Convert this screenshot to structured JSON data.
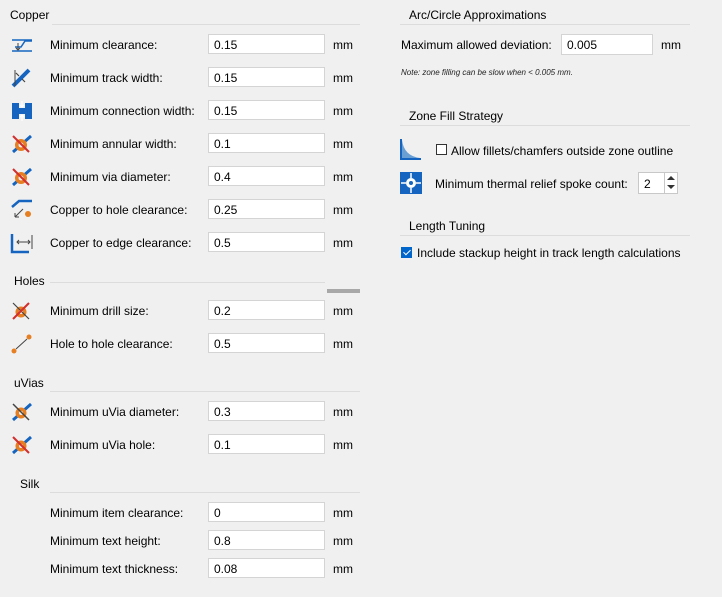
{
  "copper": {
    "title": "Copper",
    "rows": [
      {
        "icon": "clearance-icon",
        "label": "Minimum clearance:",
        "value": "0.15",
        "unit": "mm"
      },
      {
        "icon": "track-width-icon",
        "label": "Minimum track width:",
        "value": "0.15",
        "unit": "mm"
      },
      {
        "icon": "connection-width-icon",
        "label": "Minimum connection width:",
        "value": "0.15",
        "unit": "mm"
      },
      {
        "icon": "annular-width-icon",
        "label": "Minimum annular width:",
        "value": "0.1",
        "unit": "mm"
      },
      {
        "icon": "via-diameter-icon",
        "label": "Minimum via diameter:",
        "value": "0.4",
        "unit": "mm"
      },
      {
        "icon": "copper-hole-clearance-icon",
        "label": "Copper to hole clearance:",
        "value": "0.25",
        "unit": "mm"
      },
      {
        "icon": "copper-edge-clearance-icon",
        "label": "Copper to edge clearance:",
        "value": "0.5",
        "unit": "mm"
      }
    ]
  },
  "holes": {
    "title": "Holes",
    "rows": [
      {
        "icon": "drill-size-icon",
        "label": "Minimum drill size:",
        "value": "0.2",
        "unit": "mm"
      },
      {
        "icon": "hole-to-hole-icon",
        "label": "Hole to hole clearance:",
        "value": "0.5",
        "unit": "mm"
      }
    ]
  },
  "uvias": {
    "title": "uVias",
    "rows": [
      {
        "icon": "uvia-diameter-icon",
        "label": "Minimum uVia diameter:",
        "value": "0.3",
        "unit": "mm"
      },
      {
        "icon": "uvia-hole-icon",
        "label": "Minimum uVia hole:",
        "value": "0.1",
        "unit": "mm"
      }
    ]
  },
  "silk": {
    "title": "Silk",
    "rows": [
      {
        "label": "Minimum item clearance:",
        "value": "0",
        "unit": "mm"
      },
      {
        "label": "Minimum text height:",
        "value": "0.8",
        "unit": "mm"
      },
      {
        "label": "Minimum text thickness:",
        "value": "0.08",
        "unit": "mm"
      }
    ]
  },
  "arc": {
    "title": "Arc/Circle Approximations",
    "label": "Maximum allowed deviation:",
    "value": "0.005",
    "unit": "mm",
    "note": "Note: zone filling can be slow when < 0.005 mm."
  },
  "zone": {
    "title": "Zone Fill Strategy",
    "fillets_label": "Allow fillets/chamfers outside zone outline",
    "fillets_checked": false,
    "spoke_label": "Minimum thermal relief spoke count:",
    "spoke_value": "2"
  },
  "length": {
    "title": "Length Tuning",
    "stackup_label": "Include stackup height in track length calculations",
    "stackup_checked": true
  },
  "colors": {
    "accent": "#0066cc",
    "icon_blue": "#1565c0",
    "icon_orange": "#e67e22",
    "icon_red": "#d32f2f"
  }
}
